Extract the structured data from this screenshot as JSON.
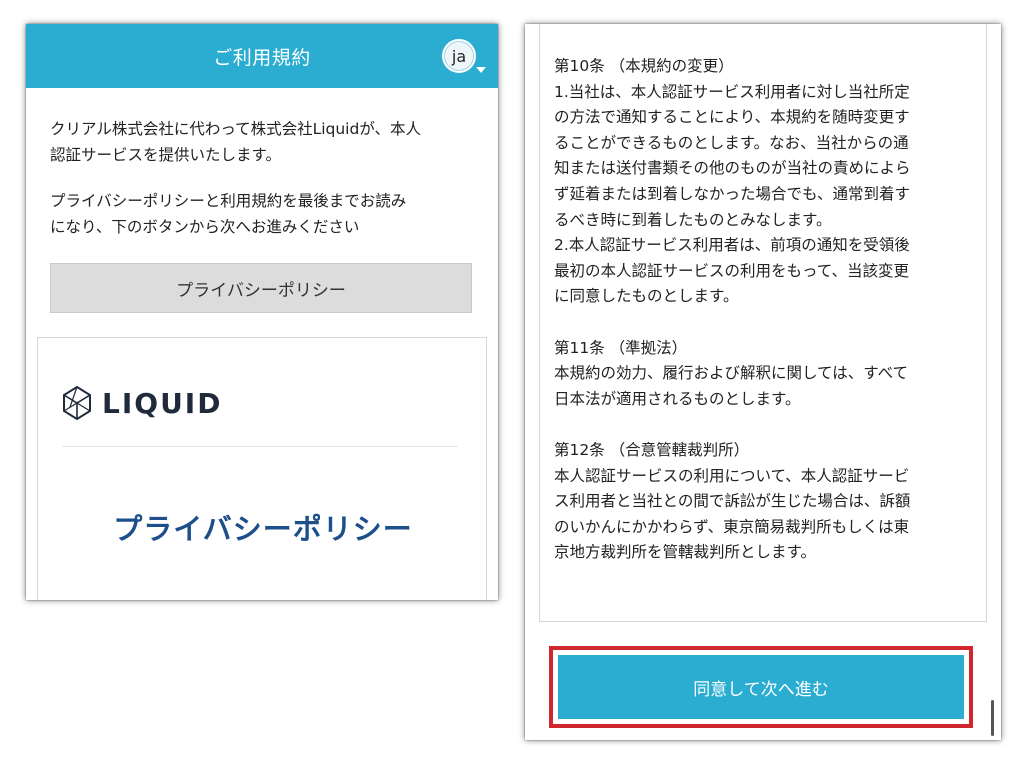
{
  "left": {
    "header_title": "ご利用規約",
    "language_button": "ja",
    "intro_lines_1": [
      "クリアル株式会社に代わって株式会社Liquidが、本人",
      "認証サービスを提供いたします。"
    ],
    "intro_lines_2": [
      "プライバシーポリシーと利用規約を最後までお読み",
      "になり、下のボタンから次へお進みください"
    ],
    "privacy_button": "プライバシーポリシー",
    "document": {
      "logo_text": "LIQUID",
      "title": "プライバシーポリシー"
    }
  },
  "right": {
    "terms_lines": [
      "第10条 （本規約の変更）",
      "1.当社は、本人認証サービス利用者に対し当社所定",
      "の方法で通知することにより、本規約を随時変更す",
      "ることができるものとします。なお、当社からの通",
      "知または送付書類その他のものが当社の責めによら",
      "ず延着または到着しなかった場合でも、通常到着す",
      "るべき時に到着したものとみなします。",
      "2.本人認証サービス利用者は、前項の通知を受領後",
      "最初の本人認証サービスの利用をもって、当該変更",
      "に同意したものとします。",
      "",
      "第11条 （準拠法）",
      "本規約の効力、履行および解釈に関しては、すべて",
      "日本法が適用されるものとします。",
      "",
      "第12条 （合意管轄裁判所）",
      "本人認証サービスの利用について、本人認証サービ",
      "ス利用者と当社との間で訴訟が生じた場合は、訴額",
      "のいかんにかかわらず、東京簡易裁判所もしくは東",
      "京地方裁判所を管轄裁判所とします。"
    ],
    "agree_button": "同意して次へ進む"
  },
  "colors": {
    "accent": "#2bacd1",
    "highlight_border": "#d0262d",
    "title_blue": "#1d4f8a"
  }
}
